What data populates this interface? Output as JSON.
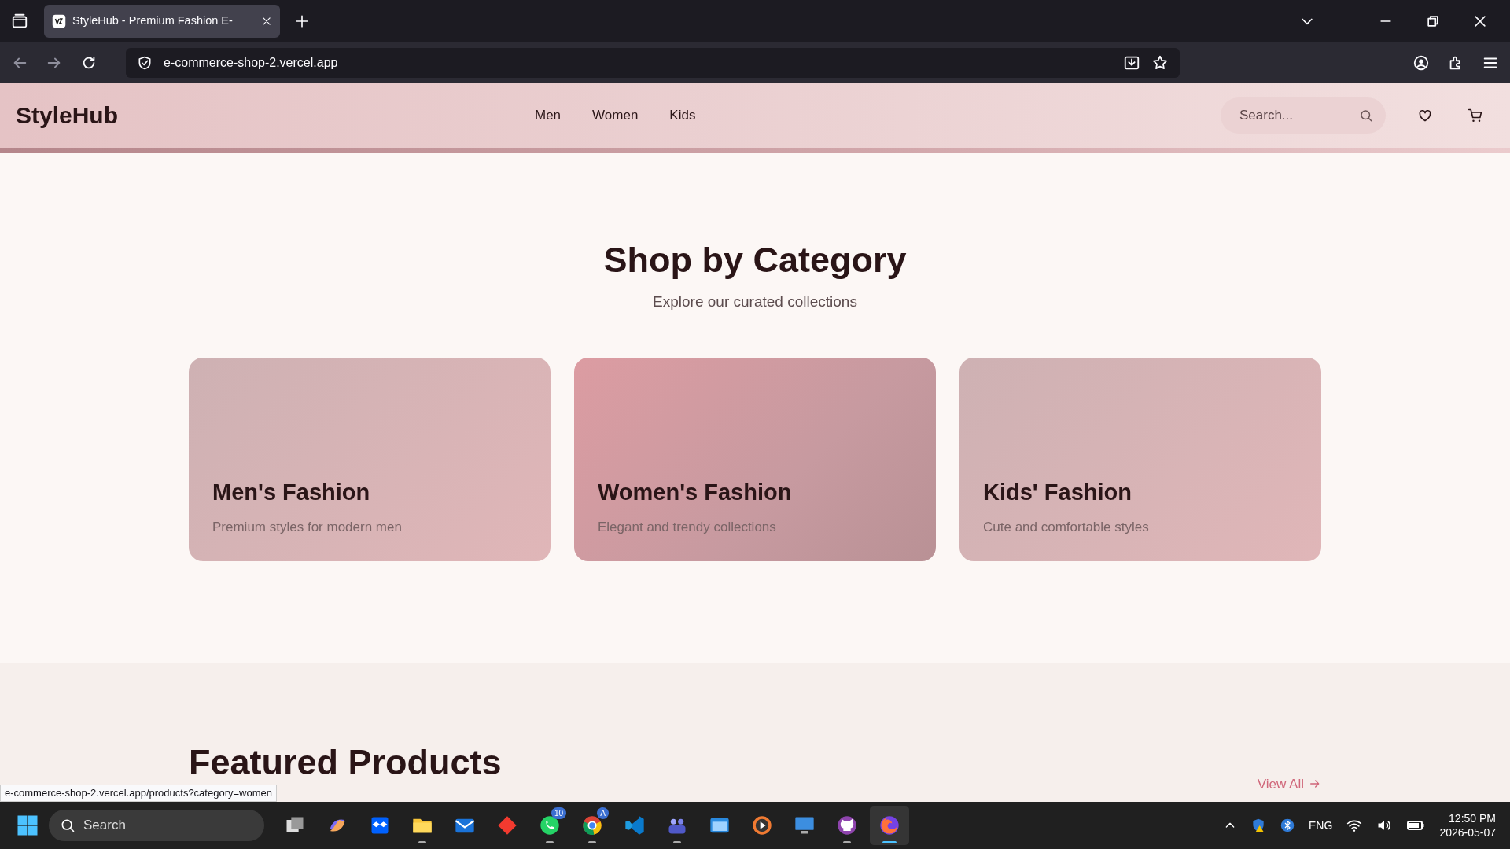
{
  "browser": {
    "tab_title": "StyleHub - Premium Fashion E-",
    "url": "e-commerce-shop-2.vercel.app"
  },
  "site": {
    "logo": "StyleHub",
    "nav": [
      {
        "label": "Men"
      },
      {
        "label": "Women"
      },
      {
        "label": "Kids"
      }
    ],
    "search": {
      "placeholder": "Search..."
    }
  },
  "category_section": {
    "title": "Shop by Category",
    "subtitle": "Explore our curated collections",
    "cards": [
      {
        "title": "Men's Fashion",
        "description": "Premium styles for modern men",
        "highlighted": false
      },
      {
        "title": "Women's Fashion",
        "description": "Elegant and trendy collections",
        "highlighted": true
      },
      {
        "title": "Kids' Fashion",
        "description": "Cute and comfortable styles",
        "highlighted": false
      }
    ]
  },
  "featured_section": {
    "title": "Featured Products",
    "link": "View All"
  },
  "status_url": "e-commerce-shop-2.vercel.app/products?category=women",
  "taskbar": {
    "search": {
      "placeholder": "Search"
    },
    "apps": [
      {
        "running": false,
        "active": false
      },
      {
        "running": false,
        "active": false
      },
      {
        "running": false,
        "active": false
      },
      {
        "running": true,
        "active": false
      },
      {
        "running": false,
        "active": false
      },
      {
        "running": false,
        "active": false
      },
      {
        "running": true,
        "active": false,
        "badge": "10"
      },
      {
        "running": true,
        "active": false,
        "badge": "A"
      },
      {
        "running": false,
        "active": false
      },
      {
        "running": true,
        "active": false
      },
      {
        "running": false,
        "active": false
      },
      {
        "running": false,
        "active": false
      },
      {
        "running": false,
        "active": false
      },
      {
        "running": true,
        "active": false
      },
      {
        "running": true,
        "active": true
      }
    ],
    "language": "ENG",
    "time": "12:50 PM",
    "date": "2026-05-07"
  }
}
